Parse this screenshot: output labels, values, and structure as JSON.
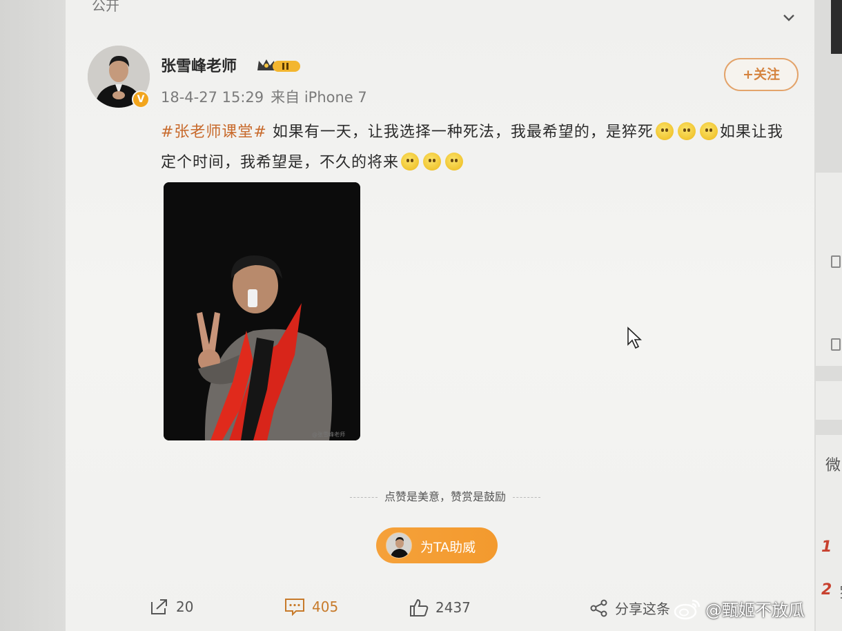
{
  "header": {
    "visibility_label": "公开"
  },
  "post": {
    "author": "张雪峰老师",
    "verified_badge": "V",
    "timestamp": "18-4-27 15:29",
    "source": "来自 iPhone 7",
    "follow_label": "+关注",
    "topic": "#张老师课堂#",
    "text_part1": " 如果有一天，让我选择一种死法，我最希望的，是猝死",
    "text_part2": "如果让我定个时间，我希望是，不久的将来",
    "photo_watermark": "@张雪峰老师"
  },
  "reward": {
    "tagline": "点赞是美意，赞赏是鼓励",
    "cheer_label": "为TA助威"
  },
  "actions": {
    "share_count": "20",
    "comment_count": "405",
    "like_count": "2437",
    "share_this_label": "分享这条"
  },
  "sidebar": {
    "title_char": "微",
    "rank_1": "1",
    "rank_2": "2",
    "rank_2_char": "罗"
  },
  "watermark": {
    "text": "@甄姬不放瓜"
  },
  "colors": {
    "accent": "#f39a2e",
    "topic": "#c86a2c",
    "follow_border": "#e3a36a"
  }
}
